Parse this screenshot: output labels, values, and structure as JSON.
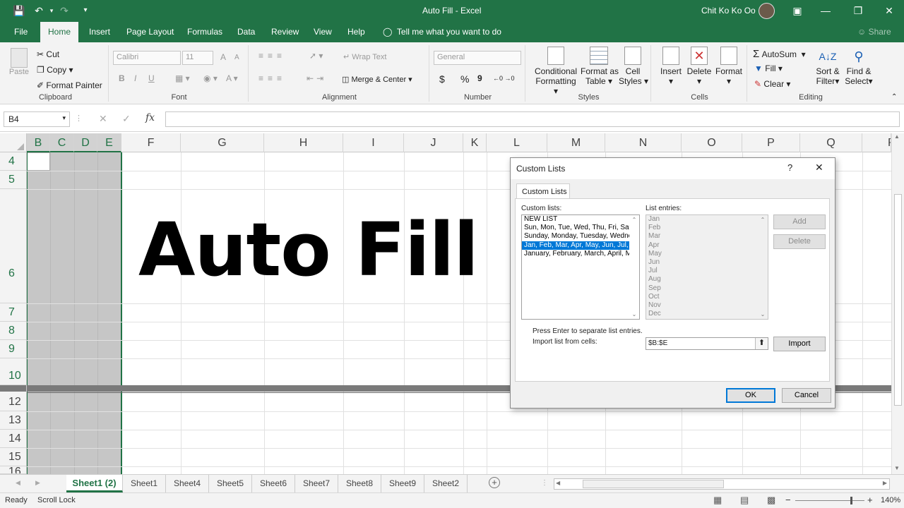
{
  "title": {
    "doc": "Auto Fill",
    "app": "Excel",
    "user": "Chit Ko Ko Oo"
  },
  "tabs": [
    "File",
    "Home",
    "Insert",
    "Page Layout",
    "Formulas",
    "Data",
    "Review",
    "View",
    "Help"
  ],
  "tell_me": "Tell me what you want to do",
  "share": "Share",
  "clipboard": {
    "paste": "Paste",
    "cut": "Cut",
    "copy": "Copy",
    "format_painter": "Format Painter",
    "label": "Clipboard"
  },
  "font": {
    "name": "Calibri",
    "size": "11",
    "bold": "B",
    "italic": "I",
    "underline": "U",
    "grow": "A",
    "shrink": "A",
    "label": "Font"
  },
  "alignment": {
    "wrap": "Wrap Text",
    "merge": "Merge & Center",
    "label": "Alignment"
  },
  "number": {
    "format": "General",
    "currency": "$",
    "percent": "%",
    "comma": "9",
    "label": "Number"
  },
  "styles": {
    "conditional": [
      "Conditional",
      "Formatting"
    ],
    "format_table": [
      "Format as",
      "Table"
    ],
    "cell_styles": [
      "Cell",
      "Styles"
    ],
    "label": "Styles"
  },
  "cells": {
    "insert": "Insert",
    "delete": "Delete",
    "format": "Format",
    "label": "Cells"
  },
  "editing": {
    "autosum": "AutoSum",
    "fill": "Fill",
    "clear": "Clear",
    "sort": [
      "Sort &",
      "Filter"
    ],
    "find": [
      "Find &",
      "Select"
    ],
    "label": "Editing"
  },
  "formula_bar": {
    "name_box": "B4",
    "cancel": "✕",
    "enter": "✓",
    "fx": "fx",
    "value": ""
  },
  "columns": [
    "B",
    "C",
    "D",
    "E",
    "F",
    "G",
    "H",
    "I",
    "J",
    "K",
    "L",
    "M",
    "N",
    "O",
    "P",
    "Q",
    "R"
  ],
  "rows": [
    "4",
    "5",
    "6",
    "7",
    "8",
    "9",
    "10",
    "12",
    "13",
    "14",
    "15",
    "16"
  ],
  "cell_text": "Auto Fill",
  "sheets": [
    "Sheet1 (2)",
    "Sheet1",
    "Sheet4",
    "Sheet5",
    "Sheet6",
    "Sheet7",
    "Sheet8",
    "Sheet9",
    "Sheet2"
  ],
  "status": {
    "ready": "Ready",
    "scroll_lock": "Scroll Lock",
    "zoom": "140%",
    "minus": "−",
    "plus": "+"
  },
  "dialog": {
    "title": "Custom Lists",
    "help": "?",
    "close": "✕",
    "tab": "Custom Lists",
    "custom_lists_label": "Custom lists:",
    "entries_label": "List entries:",
    "lists": [
      "NEW LIST",
      "Sun, Mon, Tue, Wed, Thu, Fri, Sat",
      "Sunday, Monday, Tuesday, Wednesday, Thursday",
      "Jan, Feb, Mar, Apr, May, Jun, Jul, Aug",
      "January, February, March, April, May"
    ],
    "selected_index": 3,
    "entries": [
      "Jan",
      "Feb",
      "Mar",
      "Apr",
      "May",
      "Jun",
      "Jul",
      "Aug",
      "Sep",
      "Oct",
      "Nov",
      "Dec"
    ],
    "add": "Add",
    "delete": "Delete",
    "hint": "Press Enter to separate list entries.",
    "import_label": "Import list from cells:",
    "import_value": "$B:$E",
    "import": "Import",
    "ok": "OK",
    "cancel": "Cancel"
  },
  "colors": {
    "accent": "#217346",
    "selection": "#0078d7"
  }
}
